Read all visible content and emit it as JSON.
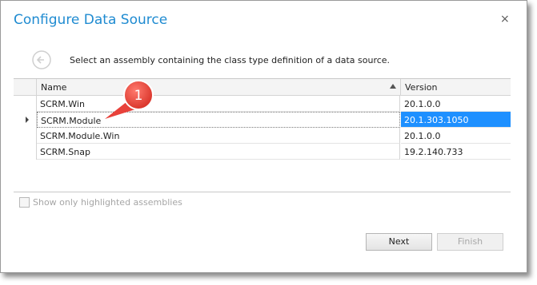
{
  "dialog": {
    "title": "Configure Data Source",
    "close_glyph": "×",
    "back_icon": "back-arrow-icon",
    "instruction": "Select an assembly containing the class type definition of a data source."
  },
  "grid": {
    "columns": [
      "Name",
      "Version"
    ],
    "sort": {
      "column": "Name",
      "direction": "ascending"
    },
    "rows": [
      {
        "name": "SCRM.Win",
        "version": "20.1.0.0",
        "selected": false
      },
      {
        "name": "SCRM.Module",
        "version": "20.1.303.1050",
        "selected": true
      },
      {
        "name": "SCRM.Module.Win",
        "version": "20.1.0.0",
        "selected": false
      },
      {
        "name": "SCRM.Snap",
        "version": "19.2.140.733",
        "selected": false
      }
    ]
  },
  "callout": {
    "label": "1",
    "color": "#e8413a"
  },
  "options": {
    "show_only_highlighted": {
      "label": "Show only highlighted assemblies",
      "checked": false,
      "enabled": false
    }
  },
  "buttons": {
    "next": "Next",
    "finish": "Finish"
  },
  "colors": {
    "title": "#1f8bd1",
    "selection": "#1e90ff"
  }
}
